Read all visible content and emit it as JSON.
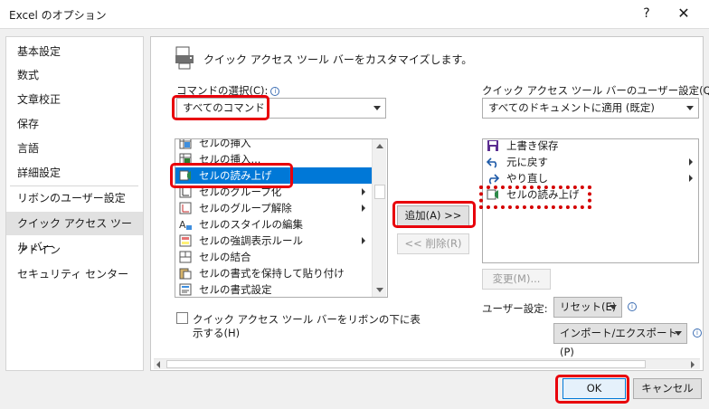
{
  "window": {
    "title": "Excel のオプション",
    "help_glyph": "?",
    "close_glyph": "✕"
  },
  "nav": {
    "items": [
      {
        "label": "基本設定"
      },
      {
        "label": "数式"
      },
      {
        "label": "文章校正"
      },
      {
        "label": "保存"
      },
      {
        "label": "言語"
      },
      {
        "label": "詳細設定"
      },
      {
        "label": "リボンのユーザー設定"
      },
      {
        "label": "クイック アクセス ツール バー",
        "active": true
      },
      {
        "label": "アドイン"
      },
      {
        "label": "セキュリティ センター"
      }
    ]
  },
  "panel": {
    "heading": "クイック アクセス ツール バーをカスタマイズします。",
    "command_select_label": "コマンドの選択(C):",
    "command_select_value": "すべてのコマンド",
    "qat_setting_label": "クイック アクセス ツール バーのユーザー設定(Q):",
    "qat_setting_value": "すべてのドキュメントに適用 (既定)",
    "commands": [
      {
        "label": "セルの挿入",
        "icon": "insert-cells-icon"
      },
      {
        "label": "セルの挿入...",
        "icon": "insert-cells-dialog-icon"
      },
      {
        "label": "セルの読み上げ",
        "icon": "speak-cells-icon",
        "selected": true
      },
      {
        "label": "セルのグループ化",
        "icon": "group-icon",
        "submenu": true
      },
      {
        "label": "セルのグループ解除",
        "icon": "ungroup-icon",
        "submenu": true
      },
      {
        "label": "セルのスタイルの編集",
        "icon": "cell-style-icon"
      },
      {
        "label": "セルの強調表示ルール",
        "icon": "highlight-rules-icon",
        "submenu": true
      },
      {
        "label": "セルの結合",
        "icon": "merge-cells-icon"
      },
      {
        "label": "セルの書式を保持して貼り付け",
        "icon": "paste-keep-format-icon"
      },
      {
        "label": "セルの書式設定",
        "icon": "format-cells-icon"
      }
    ],
    "qat_items": [
      {
        "label": "上書き保存",
        "icon": "save-icon"
      },
      {
        "label": "元に戻す",
        "icon": "undo-icon",
        "submenu": true
      },
      {
        "label": "やり直し",
        "icon": "redo-icon",
        "submenu": true
      },
      {
        "label": "セルの読み上げ",
        "icon": "speak-cells-icon"
      }
    ],
    "add_button": "追加(A) >>",
    "remove_button": "<< 削除(R)",
    "modify_button": "変更(M)...",
    "user_setting_label": "ユーザー設定:",
    "reset_button": "リセット(E)",
    "import_export_button": "インポート/エクスポート(P)",
    "checkbox_label_line1": "クイック アクセス ツール バーをリボンの下に表",
    "checkbox_label_line2": "示する(H)",
    "checkbox_checked": false
  },
  "footer": {
    "ok_button": "OK",
    "cancel_button": "キャンセル"
  },
  "colors": {
    "highlight_red": "#e8000b",
    "selection_blue": "#0078d7"
  }
}
